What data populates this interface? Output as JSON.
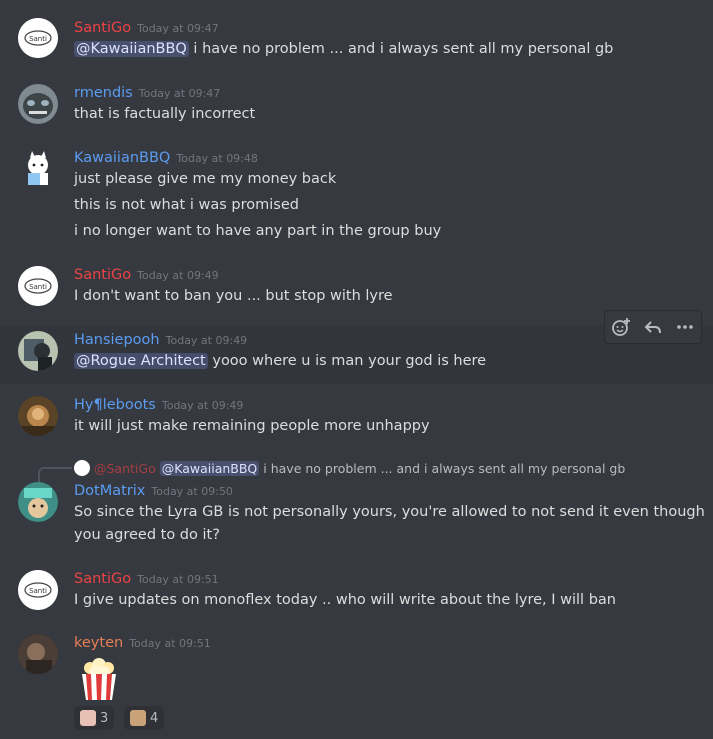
{
  "colors": {
    "santigo": "#ed4245",
    "blue": "#5b9cf1",
    "keyten": "#e67e55",
    "timestamp": "#72767d"
  },
  "messages": [
    {
      "author": "SantiGo",
      "time": "Today at 09:47",
      "lines": [
        {
          "mention": "@KawaiianBBQ",
          "text": " i have no problem ... and i always sent all my personal gb"
        }
      ]
    },
    {
      "author": "rmendis",
      "time": "Today at 09:47",
      "lines": [
        {
          "text": "that is factually incorrect"
        }
      ]
    },
    {
      "author": "KawaiianBBQ",
      "time": "Today at 09:48",
      "lines": [
        {
          "text": "just please give me my money back"
        },
        {
          "text": "this is not what i was promised"
        },
        {
          "text": "i no longer want to have any part in the group buy"
        }
      ]
    },
    {
      "author": "SantiGo",
      "time": "Today at 09:49",
      "lines": [
        {
          "text": "I don't want to ban you ... but stop with lyre"
        }
      ]
    },
    {
      "author": "Hansiepooh",
      "time": "Today at 09:49",
      "lines": [
        {
          "mention": "@Rogue Architect",
          "text": " yooo where u is man your god is here"
        }
      ]
    },
    {
      "author": "Hy¶leboots",
      "time": "Today at 09:49",
      "lines": [
        {
          "text": "it will just make remaining people more unhappy"
        }
      ]
    },
    {
      "author": "DotMatrix",
      "time": "Today at 09:50",
      "reply": {
        "author": "@SantiGo",
        "mention": "@KawaiianBBQ",
        "text": "i have no problem ... and i always sent all my personal gb"
      },
      "lines": [
        {
          "text": "So since the Lyra GB is not personally yours, you're allowed to not send it even though"
        },
        {
          "text": "you agreed to do it?"
        }
      ]
    },
    {
      "author": "SantiGo",
      "time": "Today at 09:51",
      "lines": [
        {
          "text": "I give updates on monoflex today .. who will write about the lyre, I will ban"
        }
      ]
    },
    {
      "author": "keyten",
      "time": "Today at 09:51",
      "emoji": "popcorn",
      "reactions": [
        {
          "icon": "cat-reaction",
          "count": "3"
        },
        {
          "icon": "dog-reaction",
          "count": "4"
        }
      ]
    }
  ],
  "toolbar": {
    "icons": [
      "add-reaction-icon",
      "reply-icon",
      "more-icon"
    ]
  }
}
